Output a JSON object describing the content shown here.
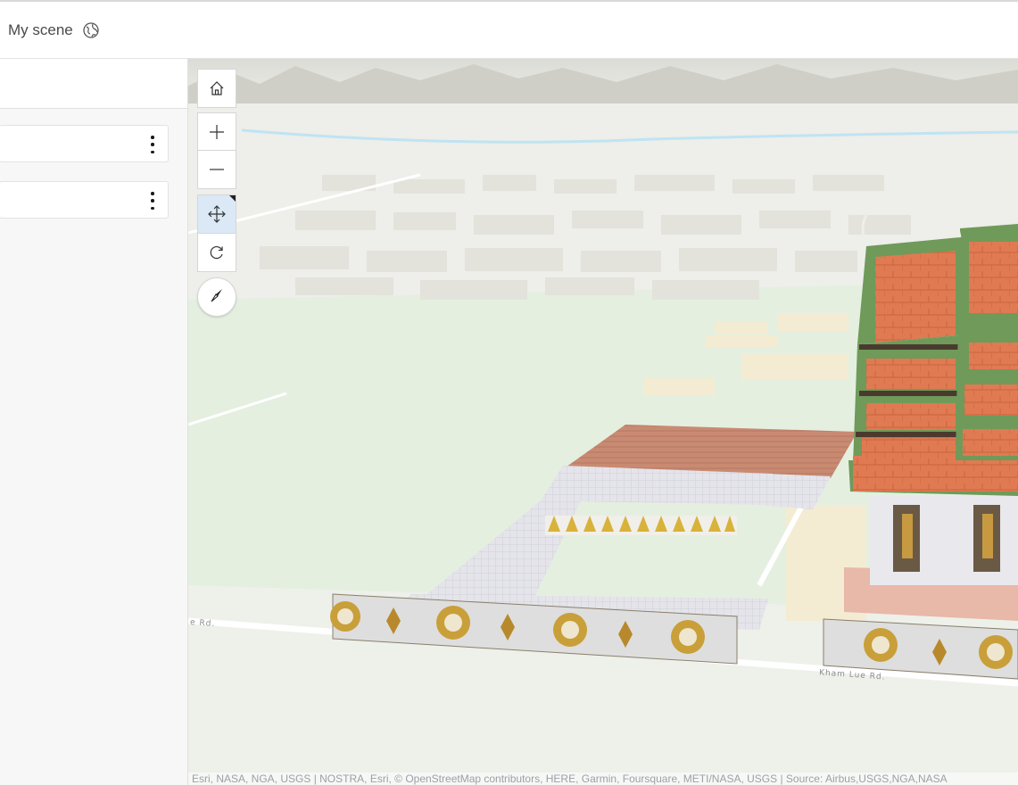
{
  "header": {
    "title": "My scene",
    "globe_icon": "globe-icon"
  },
  "sidebar": {
    "layers": [
      {
        "menu_icon": "more-vertical-icon"
      },
      {
        "menu_icon": "more-vertical-icon"
      }
    ]
  },
  "map_controls": {
    "home_icon": "home-icon",
    "zoom_in_icon": "plus-icon",
    "zoom_out_icon": "minus-icon",
    "pan_icon": "move-icon",
    "rotate_icon": "rotate-icon",
    "compass_icon": "compass-icon",
    "active_tool": "pan"
  },
  "map": {
    "road_labels": [
      "Kham Lue Rd.",
      "e Rd."
    ],
    "attribution": "Esri, NASA, NGA, USGS | NOSTRA, Esri, © OpenStreetMap contributors, HERE, Garmin, Foursquare, METI/NASA, USGS | Source: Airbus,USGS,NGA,NASA"
  },
  "colors": {
    "active_tool_bg": "#dbe9f6",
    "roof_orange": "#e07a52",
    "roof_green": "#6f9a5a",
    "ground_green": "#e3efdf",
    "land_tan": "#f3ecd2"
  }
}
